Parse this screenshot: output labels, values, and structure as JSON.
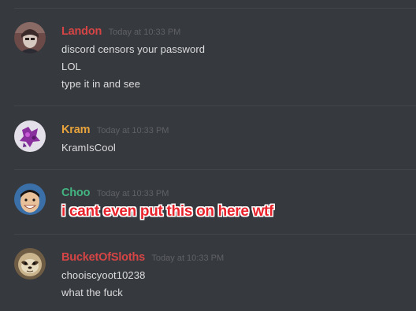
{
  "colors": {
    "background": "#36393e",
    "divider": "#42454a",
    "message_text": "#dcddde",
    "timestamp": "#5f6166"
  },
  "messages": [
    {
      "username": "Landon",
      "username_color": "#d64545",
      "timestamp": "Today at 10:33 PM",
      "avatar": "landon-avatar-icon",
      "lines": [
        "discord censors your password",
        "LOL",
        "type it in and see"
      ]
    },
    {
      "username": "Kram",
      "username_color": "#e8a33d",
      "timestamp": "Today at 10:33 PM",
      "avatar": "kram-avatar-icon",
      "lines": [
        "KramIsCool"
      ]
    },
    {
      "username": "Choo",
      "username_color": "#43b581",
      "timestamp": "Today at 10:33 PM",
      "avatar": "choo-avatar-icon",
      "lines": []
    },
    {
      "username": "BucketOfSloths",
      "username_color": "#d64545",
      "timestamp": "Today at 10:33 PM",
      "avatar": "sloth-avatar-icon",
      "lines": [
        "chooiscyoot10238",
        "what the fuck"
      ]
    }
  ],
  "overlay": {
    "text": "i cant even put this on here wtf",
    "color": "#e8222a"
  }
}
